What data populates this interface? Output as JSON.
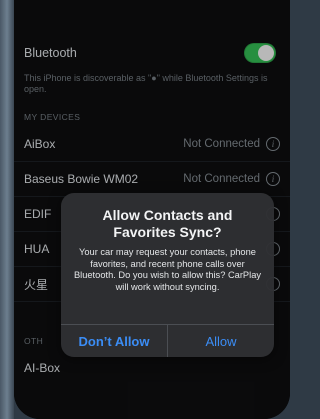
{
  "settings": {
    "bluetooth_label": "Bluetooth",
    "bluetooth_on": true,
    "discoverable_text": "This iPhone is discoverable as \"●\" while Bluetooth Settings is open.",
    "my_devices_header": "MY DEVICES",
    "devices": [
      {
        "name": "AiBox",
        "status": "Not Connected"
      },
      {
        "name": "Baseus Bowie WM02",
        "status": "Not Connected"
      },
      {
        "name": "EDIF",
        "status": ""
      },
      {
        "name": "HUA",
        "status": ""
      },
      {
        "name": "火星",
        "status": ""
      }
    ],
    "other_devices_header": "OTH",
    "other_devices": [
      {
        "name": "AI-Box"
      }
    ]
  },
  "alert": {
    "title": "Allow Contacts and Favorites Sync?",
    "message": "Your car may request your contacts, phone favorites, and recent phone calls over Bluetooth. Do you wish to allow this? CarPlay will work without syncing.",
    "dont_allow_label": "Don’t Allow",
    "allow_label": "Allow"
  },
  "colors": {
    "toggle_on": "#37c759",
    "alert_button_blue": "#3b8df5"
  },
  "icons": {
    "info": "info-icon"
  }
}
